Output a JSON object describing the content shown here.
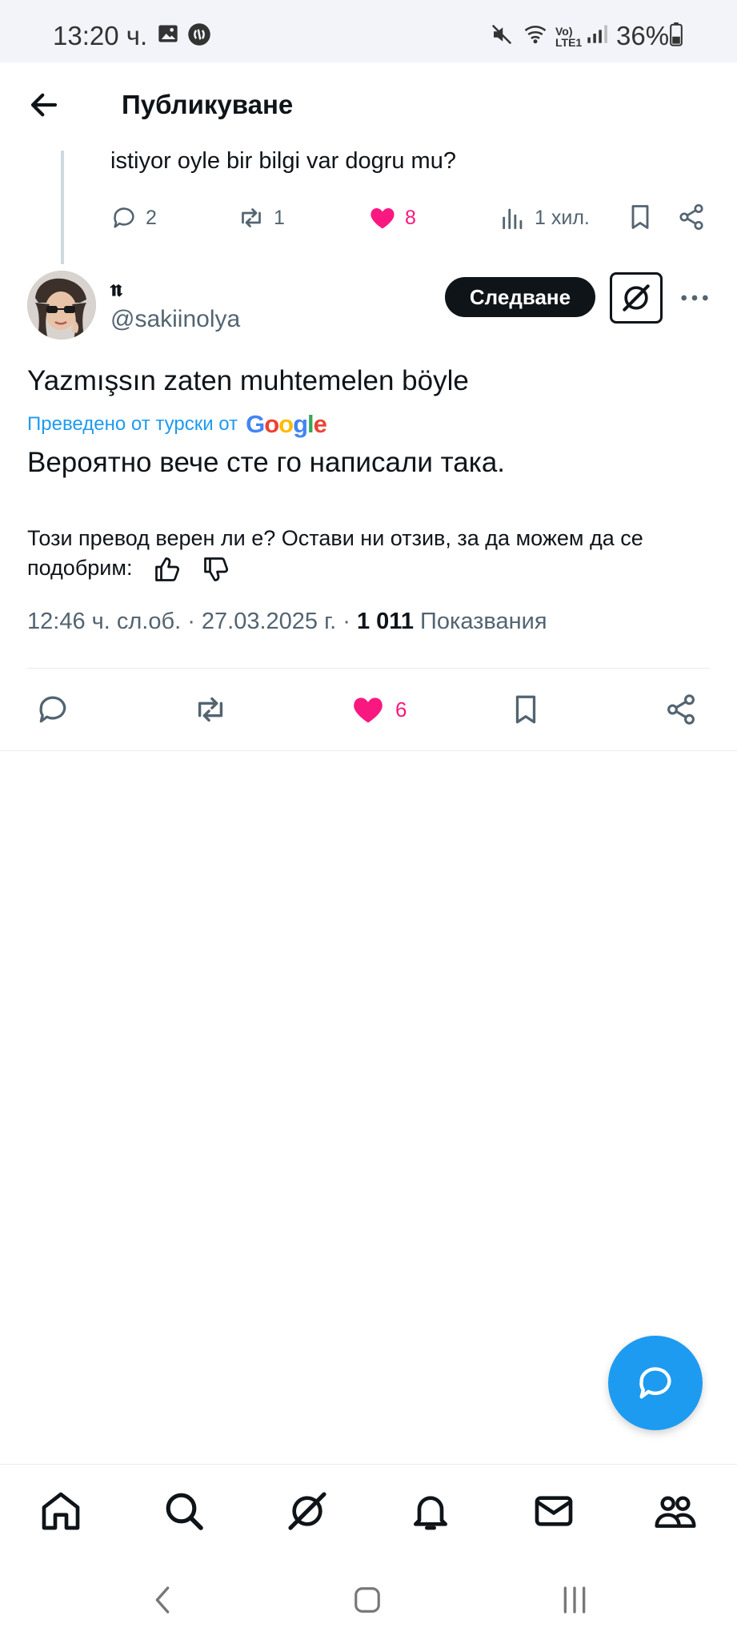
{
  "status_bar": {
    "time": "13:20 ч.",
    "battery": "36%",
    "network": "Vo) LTE1"
  },
  "header": {
    "title": "Публикуване"
  },
  "parent_tweet": {
    "text": "istiyor oyle bir bilgi var dogru mu?",
    "replies": "2",
    "reposts": "1",
    "likes": "8",
    "views": "1 хил."
  },
  "tweet": {
    "display_name": "𝖓",
    "handle": "@sakiinolya",
    "follow_label": "Следване",
    "original_text": "Yazmışsın zaten muhtemelen böyle",
    "translated_by": "Преведено от турски от",
    "google_logo": "Google",
    "translated_text": "Вероятно вече сте го написали така.",
    "feedback_prompt": "Този превод верен ли е? Остави ни отзив, за да можем да се подобрим:",
    "time": "12:46 ч. сл.об.",
    "date": "27.03.2025 г.",
    "view_count": "1 011",
    "views_label": "Показвания",
    "likes": "6"
  },
  "colors": {
    "accent": "#1d9bf0",
    "like": "#f91880",
    "text": "#0f1419",
    "muted": "#536471"
  },
  "icons": {
    "back": "arrow-left-icon",
    "grok": "grok-icon",
    "more": "more-horizontal-icon",
    "compose": "new-message-icon"
  }
}
